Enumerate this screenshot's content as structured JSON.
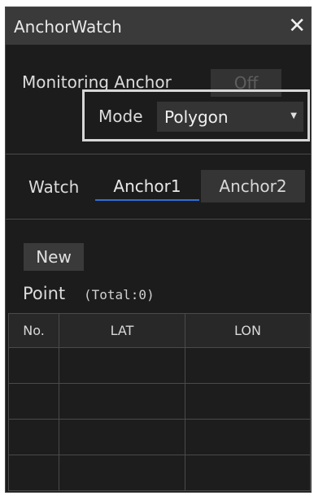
{
  "window": {
    "title": "AnchorWatch",
    "close_glyph": "✕"
  },
  "monitoring": {
    "label": "Monitoring Anchor",
    "button_label": "Off"
  },
  "mode": {
    "label": "Mode",
    "selected": "Polygon",
    "caret_glyph": "▼"
  },
  "watch": {
    "label": "Watch",
    "tabs": [
      {
        "label": "Anchor1",
        "active": true
      },
      {
        "label": "Anchor2",
        "active": false
      }
    ]
  },
  "points": {
    "new_button": "New",
    "label": "Point",
    "total": "(Total:0)",
    "columns": [
      "No.",
      "LAT",
      "LON"
    ]
  },
  "colors": {
    "panel_bg": "#1c1c1c",
    "titlebar_bg": "#3a3a3a",
    "active_tab_underline": "#2f6fd6"
  },
  "icons": {
    "close": "close-icon",
    "dropdown": "chevron-down-icon"
  }
}
